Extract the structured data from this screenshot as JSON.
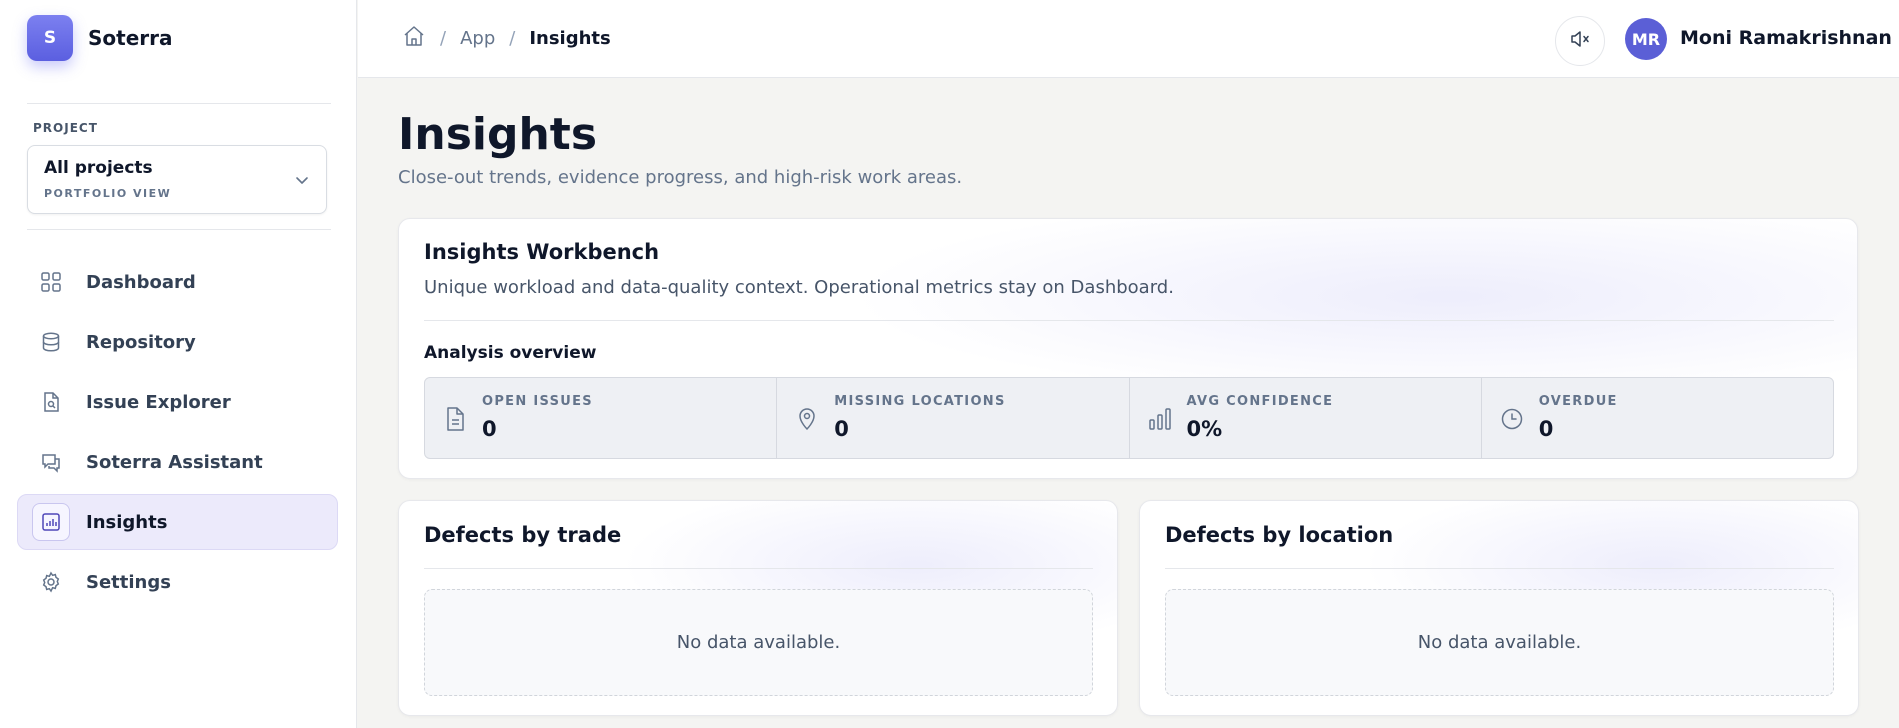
{
  "brand": {
    "logo_letter": "S",
    "name": "Soterra"
  },
  "project": {
    "label": "PROJECT",
    "name": "All projects",
    "sub": "PORTFOLIO VIEW"
  },
  "nav": {
    "items": [
      {
        "label": "Dashboard",
        "icon": "grid-icon"
      },
      {
        "label": "Repository",
        "icon": "database-icon"
      },
      {
        "label": "Issue Explorer",
        "icon": "file-search-icon"
      },
      {
        "label": "Soterra Assistant",
        "icon": "chat-icon"
      },
      {
        "label": "Insights",
        "icon": "bar-chart-icon",
        "active": true
      },
      {
        "label": "Settings",
        "icon": "gear-icon"
      }
    ]
  },
  "header": {
    "breadcrumb": {
      "sep": "/",
      "app": "App",
      "current": "Insights"
    },
    "user": {
      "initials": "MR",
      "name": "Moni Ramakrishnan"
    }
  },
  "page": {
    "title": "Insights",
    "subtitle": "Close-out trends, evidence progress, and high-risk work areas."
  },
  "workbench": {
    "title": "Insights Workbench",
    "description": "Unique workload and data-quality context. Operational metrics stay on Dashboard.",
    "overview_title": "Analysis overview",
    "metrics": [
      {
        "label": "OPEN ISSUES",
        "value": "0",
        "icon": "document-icon"
      },
      {
        "label": "MISSING LOCATIONS",
        "value": "0",
        "icon": "map-pin-icon"
      },
      {
        "label": "AVG CONFIDENCE",
        "value": "0%",
        "icon": "bar-chart-icon"
      },
      {
        "label": "OVERDUE",
        "value": "0",
        "icon": "clock-icon"
      }
    ]
  },
  "charts": {
    "trade": {
      "title": "Defects by trade",
      "empty": "No data available."
    },
    "location": {
      "title": "Defects by location",
      "empty": "No data available."
    }
  },
  "colors": {
    "accent": "#5b5fe0",
    "active_nav_bg": "#eceafb"
  }
}
